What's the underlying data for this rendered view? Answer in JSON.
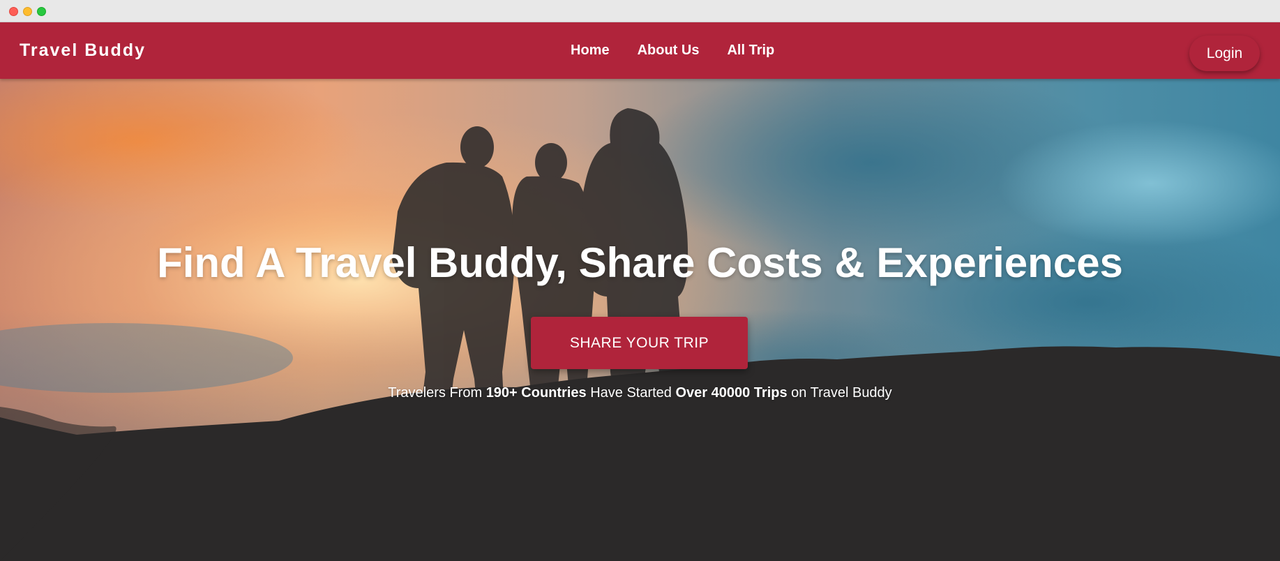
{
  "navbar": {
    "brand": "Travel Buddy",
    "links": [
      {
        "label": "Home"
      },
      {
        "label": "About Us"
      },
      {
        "label": "All Trip"
      }
    ],
    "login_label": "Login"
  },
  "hero": {
    "title": "Find A Travel Buddy, Share Costs & Experiences",
    "cta_label": "SHARE YOUR TRIP",
    "subtitle": {
      "part1": "Travelers From ",
      "countries": "190+ Countries",
      "part2": " Have Started ",
      "trips": "Over 40000 Trips",
      "part3": " on Travel Buddy"
    }
  },
  "colors": {
    "brand": "#b0243b",
    "text_on_brand": "#ffffff"
  }
}
